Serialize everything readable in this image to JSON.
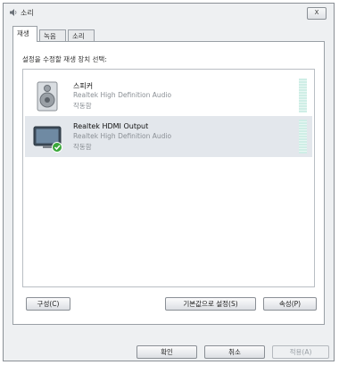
{
  "window": {
    "title": "소리",
    "close_label": "X"
  },
  "tabs": [
    {
      "label": "재생",
      "active": true
    },
    {
      "label": "녹음",
      "active": false
    },
    {
      "label": "소리",
      "active": false
    }
  ],
  "panel": {
    "instruction": "설정을 수정할 재생 장치 선택:"
  },
  "devices": [
    {
      "name": "스피커",
      "description": "Realtek High Definition Audio",
      "status": "작동함",
      "icon": "speaker-icon",
      "selected": false,
      "is_default": false
    },
    {
      "name": "Realtek HDMI Output",
      "description": "Realtek High Definition Audio",
      "status": "작동함",
      "icon": "monitor-icon",
      "selected": true,
      "is_default": true
    }
  ],
  "panel_buttons": {
    "configure": "구성(C)",
    "set_default": "기본값으로 설정(S)",
    "properties": "속성(P)"
  },
  "footer_buttons": {
    "ok": "확인",
    "cancel": "취소",
    "apply": "적용(A)"
  },
  "colors": {
    "default_check": "#3aa83a",
    "selected_row": "#e3e7ec"
  }
}
